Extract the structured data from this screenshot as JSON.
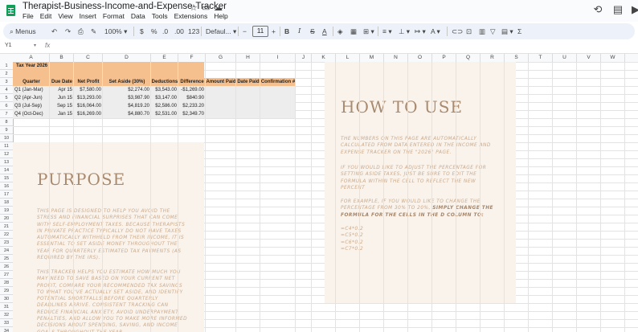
{
  "app": {
    "doc_title": "Therapist-Business-Income-and-Expense-Tracker",
    "menu": [
      "File",
      "Edit",
      "View",
      "Insert",
      "Format",
      "Data",
      "Tools",
      "Extensions",
      "Help"
    ],
    "brand_color": "#0f9d58"
  },
  "toolbar": {
    "menus_label": "Menus",
    "zoom": "100%",
    "currency": "$",
    "percent": "%",
    "dec_decrease": ".0",
    "dec_increase": ".00",
    "number_format": "123",
    "font": "Defaul...",
    "font_size": "11",
    "bold": "B",
    "italic": "I",
    "strike": "S",
    "text_color": "A"
  },
  "formula_bar": {
    "cell_ref": "Y1",
    "fx": "fx",
    "value": ""
  },
  "grid": {
    "columns": [
      "A",
      "B",
      "C",
      "D",
      "E",
      "F",
      "G",
      "H",
      "I",
      "J",
      "K",
      "L",
      "M",
      "N",
      "O",
      "P",
      "Q",
      "R",
      "S",
      "T",
      "U",
      "V",
      "W"
    ],
    "rows": [
      "1",
      "2",
      "3",
      "4",
      "5",
      "6",
      "7",
      "8",
      "9",
      "10",
      "11",
      "12",
      "13",
      "14",
      "15",
      "16",
      "17",
      "18",
      "19",
      "20",
      "21",
      "22",
      "23",
      "24",
      "25",
      "26",
      "27",
      "28",
      "29",
      "30",
      "31",
      "32",
      "33",
      "34"
    ]
  },
  "table": {
    "tax_year_label": "Tax Year 2026",
    "headers": [
      "Quarter",
      "Due Date",
      "Net Profit",
      "Set Aside (30%)",
      "Deductions",
      "Difference",
      "Amount Paid",
      "Date Paid",
      "Confirmation #"
    ],
    "rows": [
      [
        "Q1 (Jan-Mar)",
        "Apr 15",
        "$7,580.00",
        "$2,274.00",
        "$3,543.00",
        "-$1,269.00",
        "",
        "",
        ""
      ],
      [
        "Q2 (Apr-Jun)",
        "Jun 15",
        "$13,293.00",
        "$3,987.90",
        "$3,147.00",
        "$840.90",
        "",
        "",
        ""
      ],
      [
        "Q3 (Jul-Sep)",
        "Sep 15",
        "$16,064.00",
        "$4,819.20",
        "$2,586.00",
        "$2,233.20",
        "",
        "",
        ""
      ],
      [
        "Q4 (Oct-Dec)",
        "Jan 15",
        "$16,269.00",
        "$4,880.70",
        "$2,531.00",
        "$2,349.70",
        "",
        "",
        ""
      ]
    ],
    "header_color": "#f6c08e",
    "row_color": "#ededed"
  },
  "purpose": {
    "title": "PURPOSE",
    "para1": "This page is designed to help you avoid the stress and financial surprises that can come with self-employment taxes. Because therapists in private practice typically do not have taxes automatically withheld from their income, it is essential to set aside money throughout the year for quarterly estimated tax payments (as required by the IRS).",
    "para2": "This tracker helps you estimate how much you may need to save based on your current net profit, compare your recommended tax savings to what you've actually set aside, and identify potential shortfalls before quarterly deadlines arrive. Consistent tracking can reduce financial anxiety, avoid underpayment penalties, and allow you to make more informed decisions about spending, saving, and income goals throughout the year."
  },
  "howto": {
    "title": "HOW TO USE",
    "para1": "The numbers on this page are automatically calculated from data entered in the Income and Expense Tracker on the \"2026\" page.",
    "para2": "If you would like to adjust the percentage for setting aside taxes, just be sure to edit the formula within the cell to reflect the new percent",
    "para3_plain": "For example, if you would like to change the percentage from 30% to 20%, ",
    "para3_bold": "simply change the formula for the cells in the D column to:",
    "formulas": [
      "=C4*0.2",
      "=C5*0.2",
      "=C6*0.2",
      "=C7*0.2"
    ]
  },
  "colors": {
    "panel_bg": "#faf3ec",
    "panel_title": "#a88a6f",
    "panel_text": "#c9a98a"
  }
}
